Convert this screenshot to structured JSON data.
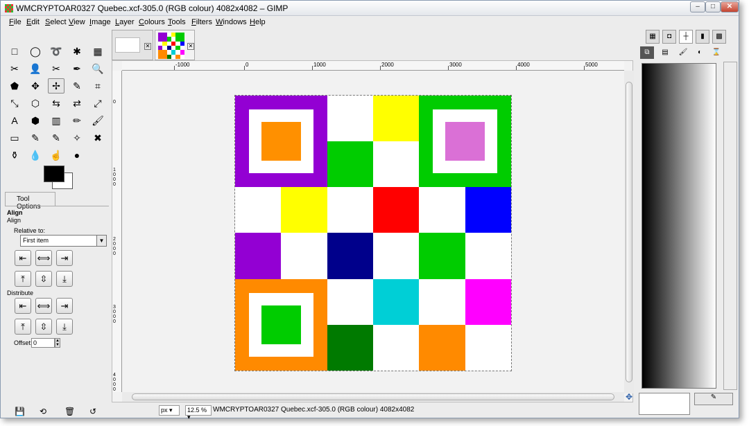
{
  "window": {
    "title": "WMCRYPTOAR0327 Quebec.xcf-305.0 (RGB colour) 4082x4082 – GIMP",
    "buttons": {
      "minimize": "–",
      "maximize": "□",
      "close": "✕"
    }
  },
  "menubar": [
    "File",
    "Edit",
    "Select",
    "View",
    "Image",
    "Layer",
    "Colours",
    "Tools",
    "Filters",
    "Windows",
    "Help"
  ],
  "toolbox": {
    "tools": [
      "□",
      "◯",
      "➰",
      "✱",
      "▦",
      "✂",
      "👤",
      "✂",
      "✒",
      "🔍",
      "⬟",
      "✥",
      "✢",
      "✎",
      "⌗",
      "⤡",
      "⬡",
      "⇆",
      "⇄",
      "⤢",
      "A",
      "⬢",
      "▥",
      "✏",
      "🖌",
      "▭",
      "✎",
      "✎",
      "✧",
      "✖",
      "⚱",
      "💧",
      "☝",
      "●"
    ],
    "tool_options_tab": "Tool Options"
  },
  "tool_options": {
    "title": "Align",
    "subtitle": "Align",
    "relative_to_label": "Relative to:",
    "relative_to_value": "First item",
    "distribute_label": "Distribute",
    "offset_label": "Offset:",
    "offset_value": "0",
    "align_buttons": [
      "⇤",
      "⟺",
      "⇥",
      "⤒",
      "⇳",
      "⤓"
    ],
    "distribute_buttons": [
      "⇤",
      "⟺",
      "⇥",
      "⤒",
      "⇳",
      "⤓"
    ]
  },
  "ruler": {
    "h_labels": [
      "-1000",
      "0",
      "1000",
      "2000",
      "3000",
      "4000",
      "5000"
    ],
    "v_labels": [
      "0",
      "1000",
      "2000",
      "3000",
      "4000"
    ]
  },
  "image_colors": {
    "purple": "#9300d3",
    "orange": "#ff9000",
    "darkorange": "#ff8a00",
    "green": "#00cc00",
    "darkgreen": "#007a00",
    "yellow": "#ffff00",
    "red": "#ff0000",
    "blue": "#0000ff",
    "navy": "#00008b",
    "cyan": "#00cfd6",
    "magenta": "#ff00ff",
    "orchid": "#da70d6",
    "white": "#ffffff"
  },
  "statusbar": {
    "units": "px",
    "zoom": "12.5 %",
    "text": "WMCRYPTOAR0327 Quebec.xcf-305.0 (RGB colour) 4082x4082"
  }
}
